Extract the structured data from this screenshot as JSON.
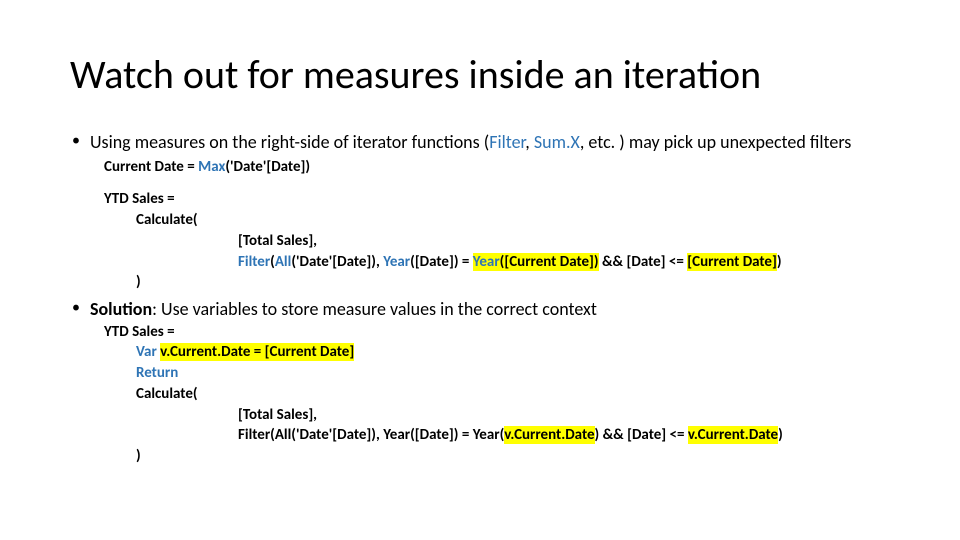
{
  "title": "Watch out for measures inside an iteration",
  "bullet1": {
    "pre": "Using measures on the right-side of iterator functions (",
    "fn1": "Filter",
    "sep1": ", ",
    "fn2": "Sum.X",
    "post": ", etc. ) may pick up unexpected filters"
  },
  "code1": {
    "currentDate_pre": "Current Date = ",
    "currentDate_fn": "Max",
    "currentDate_post": "('Date'[Date])",
    "ytd": "YTD Sales =",
    "calc": "Calculate(",
    "total": "[Total Sales],",
    "filter_fn": "Filter",
    "filter_mid1": "(",
    "filter_all": "All",
    "filter_mid1b": "('Date'[Date]), ",
    "filter_year1": "Year",
    "filter_mid2": "([Date]) = ",
    "filter_hl1_pre": "Year",
    "filter_hl1_post": "([Current Date])",
    "filter_mid3": " && [Date] <= ",
    "filter_hl2": "[Current Date]",
    "filter_end": ")",
    "close": ")"
  },
  "bullet2": {
    "strong": "Solution",
    "rest": ": Use variables to store measure values in the correct context"
  },
  "code2": {
    "ytd": "YTD Sales =",
    "var_pre": "Var ",
    "var_hl": "v.Current.Date = [Current Date]",
    "ret": "Return",
    "calc": "Calculate(",
    "total": "[Total Sales],",
    "filter_pre": "Filter(All('Date'[Date]), Year([Date]) = Year(",
    "filter_hl1": "v.Current.Date",
    "filter_mid": ") && [Date] <= ",
    "filter_hl2": "v.Current.Date",
    "filter_end": ")",
    "close": ")"
  }
}
